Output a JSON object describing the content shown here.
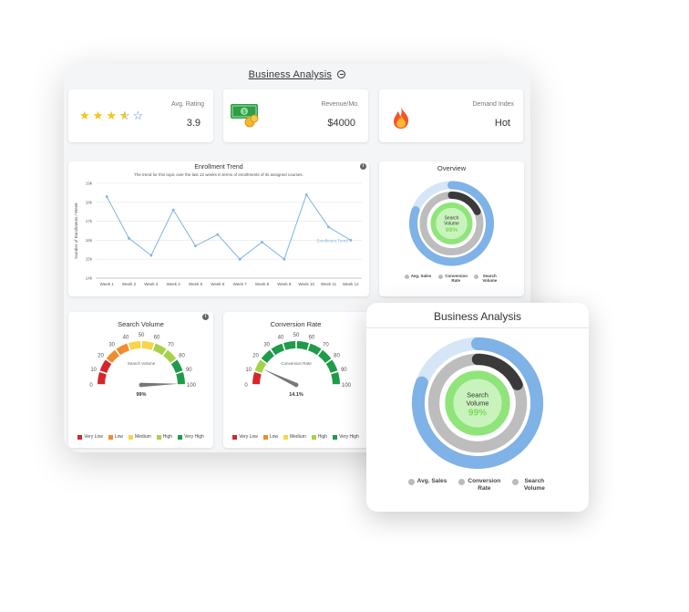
{
  "main": {
    "title": "Business Analysis",
    "kpis": {
      "rating": {
        "label": "Avg. Rating",
        "value": "3.9",
        "stars": 3.5
      },
      "revenue": {
        "label": "Revenue/Mo.",
        "value": "$4000"
      },
      "demand": {
        "label": "Demand Index",
        "value": "Hot"
      }
    },
    "trend": {
      "title": "Enrollment Trend",
      "subtitle": "The trend for this topic over the last 12 weeks in terms of enrollments of its assigned courses.",
      "ylabel": "Number of Enrollments / Week",
      "series_label": "Enrollment Trend",
      "info": "i"
    },
    "overview": {
      "title": "Overview",
      "center_label_1": "Search",
      "center_label_2": "Volume",
      "center_value": "99%",
      "legend": [
        "Avg. Sales",
        "Conversion Rate",
        "Search Volume"
      ]
    },
    "search_gauge": {
      "title": "Search Volume",
      "inner_label": "Search Volume",
      "value_text": "99%",
      "value": 99,
      "ticks": [
        "0",
        "10",
        "20",
        "30",
        "40",
        "50",
        "60",
        "70",
        "80",
        "90",
        "100"
      ],
      "info": "i"
    },
    "conversion_gauge": {
      "title": "Conversion Rate",
      "inner_label": "Conversion Rate",
      "value_text": "14.1%",
      "value": 14.1,
      "ticks": [
        "0",
        "10",
        "20",
        "30",
        "40",
        "50",
        "60",
        "70",
        "80",
        "90",
        "100"
      ]
    },
    "gauge_legend": [
      "Very Low",
      "Low",
      "Medium",
      "High",
      "Very High"
    ],
    "gauge_colors": [
      "#d6262b",
      "#f28a2e",
      "#f7d44a",
      "#a6d24a",
      "#1f9b4a"
    ]
  },
  "popup": {
    "title": "Business Analysis",
    "center_label_1": "Search",
    "center_label_2": "Volume",
    "center_value": "99%",
    "legend": [
      "Avg. Sales",
      "Conversion Rate",
      "Search Volume"
    ]
  },
  "colors": {
    "line": "#7fb2e6",
    "ring_outer": "#7fb2e6",
    "ring_outer_track": "#d6e6f7",
    "ring_mid": "#bdbdbd",
    "ring_mid_dark": "#3a3a3a",
    "ring_inner": "#8fe57a",
    "ring_inner_track": "#c9f3bd",
    "center_value": "#7ed957"
  },
  "chart_data": {
    "type": "line",
    "title": "Enrollment Trend",
    "ylabel": "Number of Enrollments / Week",
    "categories": [
      "Week 1",
      "Week 2",
      "Week 3",
      "Week 4",
      "Week 5",
      "Week 6",
      "Week 7",
      "Week 8",
      "Week 9",
      "Week 10",
      "Week 11",
      "Week 12"
    ],
    "y_ticks": [
      "14k",
      "15k",
      "16k",
      "17k",
      "18k",
      "19k"
    ],
    "ylim": [
      14,
      19
    ],
    "series": [
      {
        "name": "Enrollment Trend",
        "values": [
          18.3,
          16.1,
          15.2,
          17.6,
          15.7,
          16.3,
          15.0,
          15.9,
          15.0,
          18.4,
          16.7,
          16.0
        ]
      }
    ],
    "grid": true
  }
}
